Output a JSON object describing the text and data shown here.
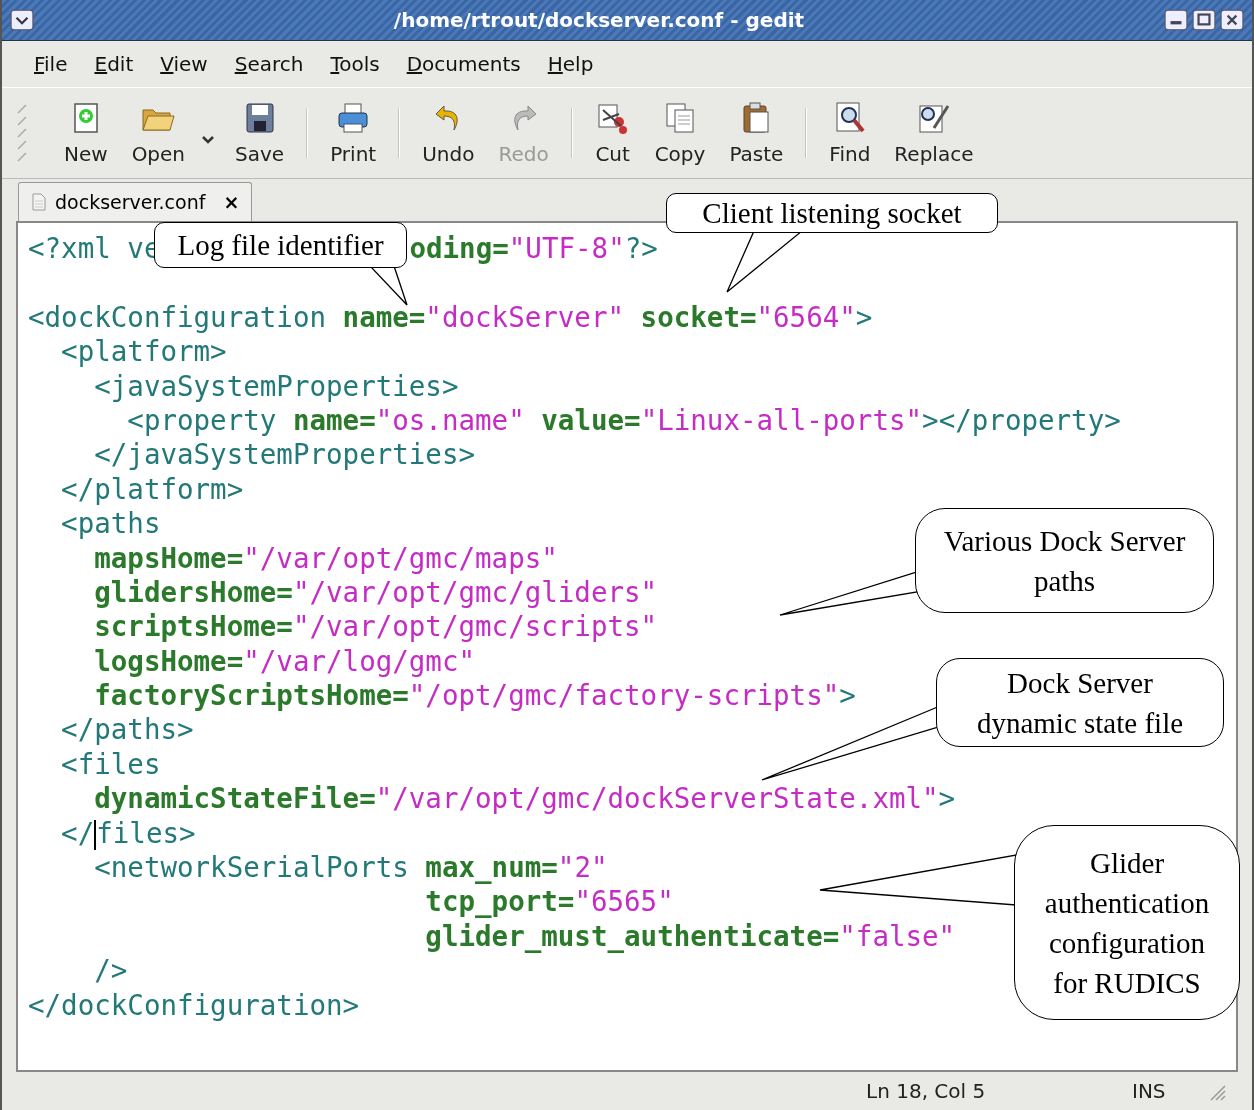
{
  "window": {
    "title": "/home/rtrout/dockserver.conf - gedit"
  },
  "menu": [
    "File",
    "Edit",
    "View",
    "Search",
    "Tools",
    "Documents",
    "Help"
  ],
  "toolbar": [
    {
      "kind": "button",
      "label": "New",
      "disabled": false
    },
    {
      "kind": "button",
      "label": "Open",
      "disabled": false
    },
    {
      "kind": "dropdown"
    },
    {
      "kind": "button",
      "label": "Save",
      "disabled": false
    },
    {
      "kind": "separator"
    },
    {
      "kind": "button",
      "label": "Print",
      "disabled": false
    },
    {
      "kind": "separator"
    },
    {
      "kind": "button",
      "label": "Undo",
      "disabled": false
    },
    {
      "kind": "button",
      "label": "Redo",
      "disabled": true
    },
    {
      "kind": "separator"
    },
    {
      "kind": "button",
      "label": "Cut",
      "disabled": false
    },
    {
      "kind": "button",
      "label": "Copy",
      "disabled": false
    },
    {
      "kind": "button",
      "label": "Paste",
      "disabled": false
    },
    {
      "kind": "separator"
    },
    {
      "kind": "button",
      "label": "Find",
      "disabled": false
    },
    {
      "kind": "button",
      "label": "Replace",
      "disabled": false
    }
  ],
  "tabs": [
    {
      "label": "dockserver.conf",
      "close": "×",
      "selected": true
    }
  ],
  "editor": {
    "lines": [
      {
        "tokens": [
          {
            "text": "<?xml ve",
            "kind": "tag"
          },
          {
            "text": "oding=",
            "kind": "attr"
          },
          {
            "text": "\"UTF-8\"",
            "kind": "value"
          },
          {
            "text": "?>",
            "kind": "tag"
          }
        ]
      },
      {
        "tokens": [
          {
            "text": "<dockConfiguration",
            "kind": "tag"
          },
          {
            "text": " name=",
            "kind": "attr"
          },
          {
            "text": "\"dockServer\"",
            "kind": "value"
          },
          {
            "text": " socket=",
            "kind": "attr"
          },
          {
            "text": "\"6564\"",
            "kind": "value"
          },
          {
            "text": ">",
            "kind": "tag"
          }
        ]
      },
      {
        "tokens": [
          {
            "text": "  <platform>",
            "kind": "tag"
          }
        ]
      },
      {
        "tokens": [
          {
            "text": "    <javaSystemProperties>",
            "kind": "tag"
          }
        ]
      },
      {
        "tokens": [
          {
            "text": "      <property",
            "kind": "tag"
          },
          {
            "text": " name=",
            "kind": "attr"
          },
          {
            "text": "\"os.name\"",
            "kind": "value"
          },
          {
            "text": " value=",
            "kind": "attr"
          },
          {
            "text": "\"Linux-all-ports\"",
            "kind": "value"
          },
          {
            "text": "></property>",
            "kind": "tag"
          }
        ]
      },
      {
        "tokens": [
          {
            "text": "    </javaSystemProperties>",
            "kind": "tag"
          }
        ]
      },
      {
        "tokens": [
          {
            "text": "  </platform>",
            "kind": "tag"
          }
        ]
      },
      {
        "tokens": [
          {
            "text": "  <paths",
            "kind": "tag"
          }
        ]
      },
      {
        "tokens": [
          {
            "text": "    mapsHome=",
            "kind": "attr"
          },
          {
            "text": "\"/var/opt/gmc/maps\"",
            "kind": "value"
          }
        ]
      },
      {
        "tokens": [
          {
            "text": "    glidersHome=",
            "kind": "attr"
          },
          {
            "text": "\"/var/opt/gmc/gliders\"",
            "kind": "value"
          }
        ]
      },
      {
        "tokens": [
          {
            "text": "    scriptsHome=",
            "kind": "attr"
          },
          {
            "text": "\"/var/opt/gmc/scripts\"",
            "kind": "value"
          }
        ]
      },
      {
        "tokens": [
          {
            "text": "    logsHome=",
            "kind": "attr"
          },
          {
            "text": "\"/var/log/gmc\"",
            "kind": "value"
          }
        ]
      },
      {
        "tokens": [
          {
            "text": "    factoryScriptsHome=",
            "kind": "attr"
          },
          {
            "text": "\"/opt/gmc/factory-scripts\"",
            "kind": "value"
          },
          {
            "text": ">",
            "kind": "tag"
          }
        ]
      },
      {
        "tokens": [
          {
            "text": "  </paths>",
            "kind": "tag"
          }
        ]
      },
      {
        "tokens": [
          {
            "text": "  <files",
            "kind": "tag"
          }
        ]
      },
      {
        "tokens": [
          {
            "text": "    dynamicStateFile=",
            "kind": "attr"
          },
          {
            "text": "\"/var/opt/gmc/dockServerState.xml\"",
            "kind": "value"
          },
          {
            "text": ">",
            "kind": "tag"
          }
        ]
      },
      {
        "tokens": [
          {
            "text": "  </",
            "kind": "tag"
          },
          {
            "text": "files>",
            "kind": "tag",
            "cursor_before": true
          }
        ]
      },
      {
        "tokens": [
          {
            "text": "    <networkSerialPorts",
            "kind": "tag"
          },
          {
            "text": " max_num=",
            "kind": "attr"
          },
          {
            "text": "\"2\"",
            "kind": "value"
          }
        ]
      },
      {
        "tokens": [
          {
            "text": "                        tcp_port=",
            "kind": "attr"
          },
          {
            "text": "\"6565\"",
            "kind": "value"
          }
        ]
      },
      {
        "tokens": [
          {
            "text": "                        glider_must_authenticate=",
            "kind": "attr"
          },
          {
            "text": "\"false\"",
            "kind": "value"
          }
        ]
      },
      {
        "tokens": [
          {
            "text": "    />",
            "kind": "tag"
          }
        ]
      },
      {
        "tokens": [
          {
            "text": "</dockConfiguration>",
            "kind": "tag"
          }
        ]
      }
    ]
  },
  "callouts": [
    {
      "lines": [
        "Log file identifier"
      ]
    },
    {
      "lines": [
        "Client listening socket"
      ]
    },
    {
      "lines": [
        "Various Dock Server",
        "paths"
      ]
    },
    {
      "lines": [
        "Dock Server",
        "dynamic state file"
      ]
    },
    {
      "lines": [
        "Glider",
        "authentication",
        "configuration",
        "for RUDICS"
      ]
    }
  ],
  "status_bar": {
    "position": "Ln 18, Col 5",
    "mode": "INS"
  }
}
